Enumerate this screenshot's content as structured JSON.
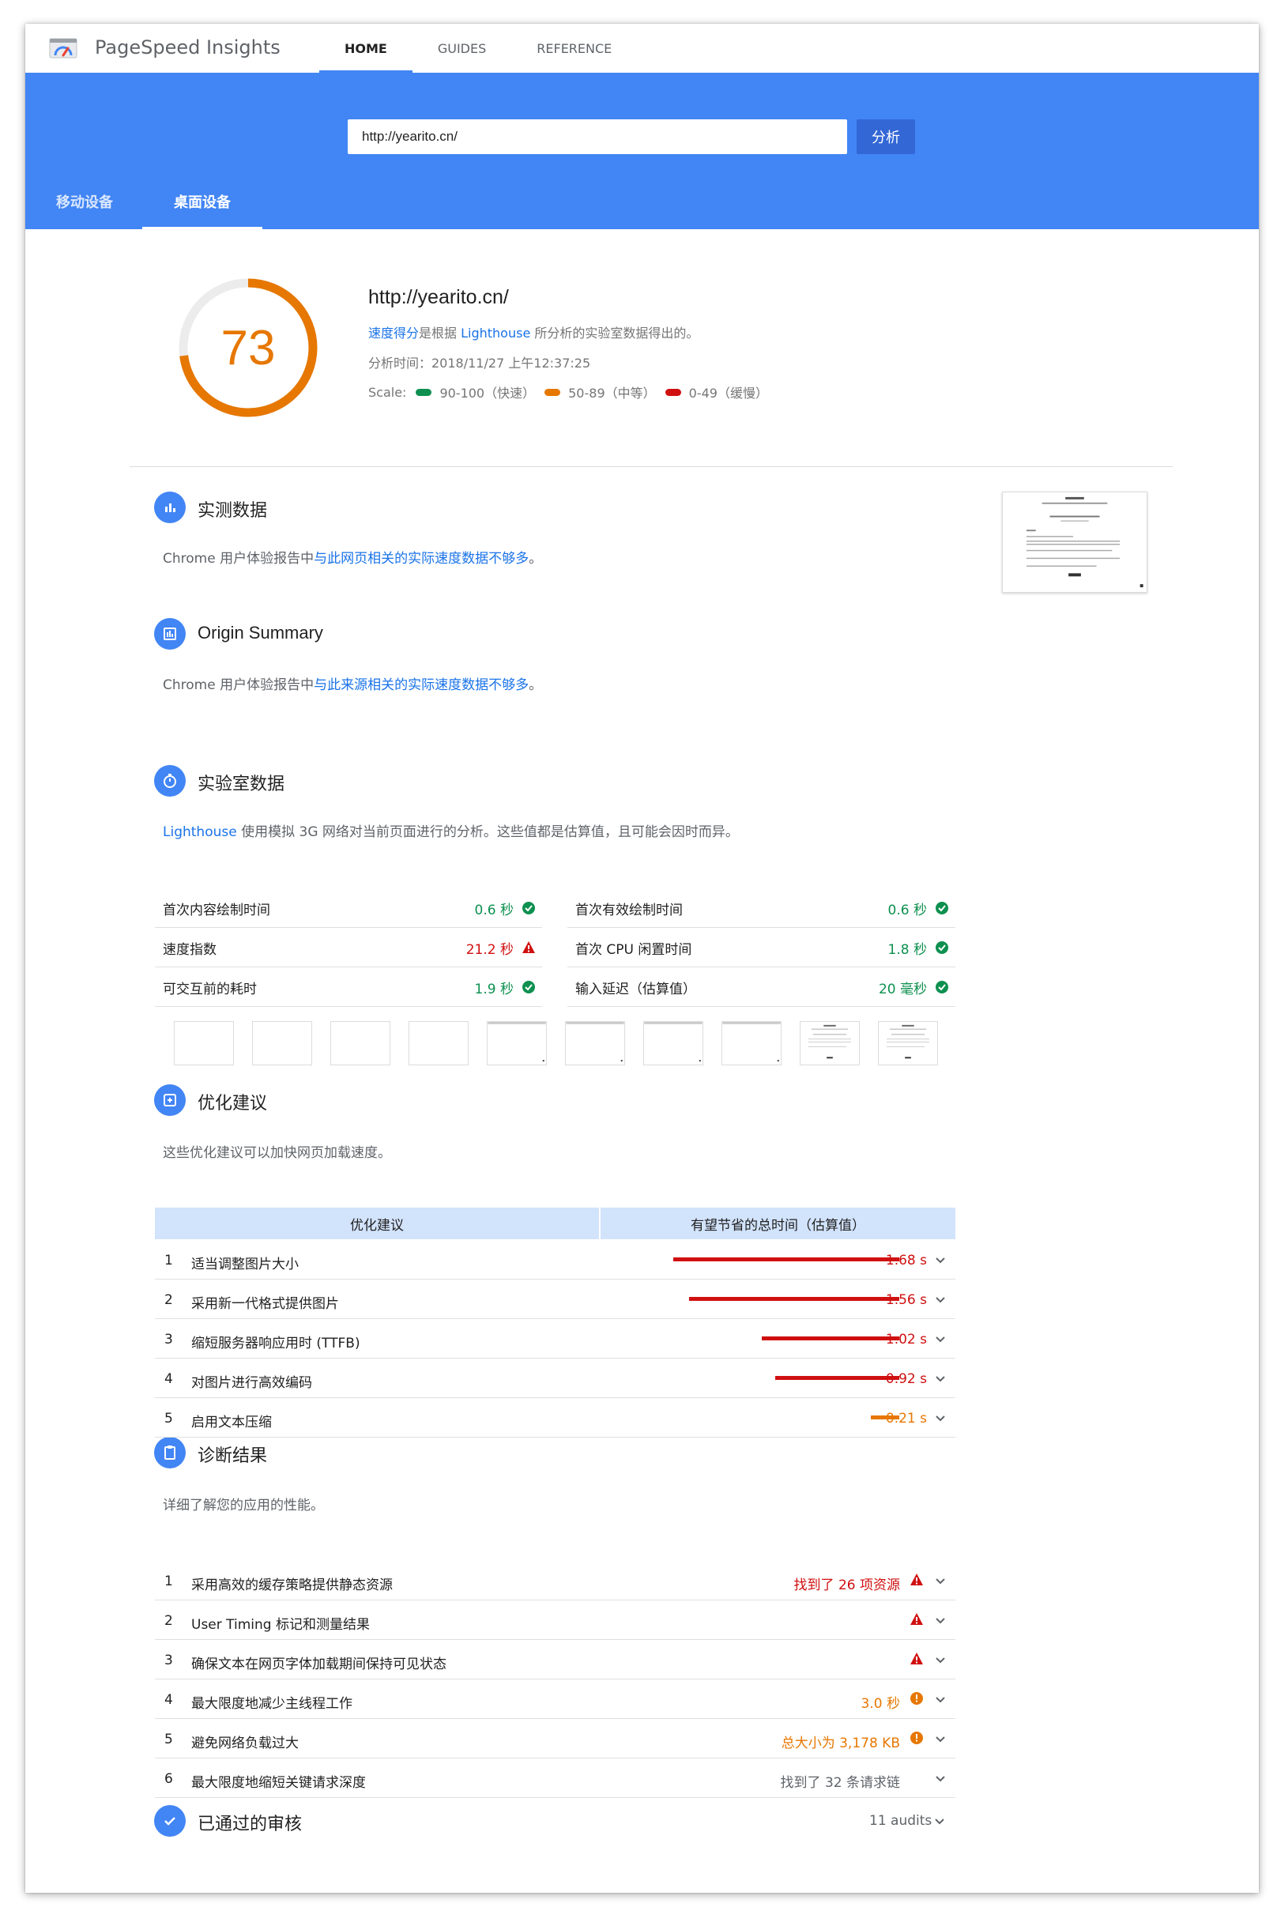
{
  "header": {
    "brand": "PageSpeed Insights",
    "nav": [
      "HOME",
      "GUIDES",
      "REFERENCE"
    ]
  },
  "search": {
    "url_value": "http://yearito.cn/",
    "analyze_label": "分析"
  },
  "device_tabs": [
    "移动设备",
    "桌面设备"
  ],
  "score": {
    "value": "73",
    "percent": 73,
    "url": "http://yearito.cn/",
    "desc_link1": "速度得分",
    "desc_mid": "是根据 ",
    "desc_link2": "Lighthouse",
    "desc_end": " 所分析的实验室数据得出的。",
    "analysis_time": "分析时间：2018/11/27 上午12:37:25",
    "scale_label": "Scale:",
    "scale_fast": "90-100（快速）",
    "scale_mid": "50-89（中等）",
    "scale_slow": "0-49（缓慢）",
    "colors": {
      "good": "#0d904f",
      "average": "#e67700",
      "poor": "#d01010"
    }
  },
  "field_data": {
    "title": "实测数据",
    "text_prefix": "Chrome 用户体验报告中",
    "text_link": "与此网页相关的实际速度数据不够多",
    "text_suffix": "。"
  },
  "origin_summary": {
    "title": "Origin Summary",
    "text_prefix": "Chrome 用户体验报告中",
    "text_link": "与此来源相关的实际速度数据不够多",
    "text_suffix": "。"
  },
  "lab_data": {
    "title": "实验室数据",
    "text_link": "Lighthouse",
    "text_rest": " 使用模拟 3G 网络对当前页面进行的分析。这些值都是估算值，且可能会因时而异。",
    "metrics": [
      {
        "label": "首次内容绘制时间",
        "value": "0.6 秒",
        "status": "good"
      },
      {
        "label": "首次有效绘制时间",
        "value": "0.6 秒",
        "status": "good"
      },
      {
        "label": "速度指数",
        "value": "21.2 秒",
        "status": "bad"
      },
      {
        "label": "首次 CPU 闲置时间",
        "value": "1.8 秒",
        "status": "good"
      },
      {
        "label": "可交互前的耗时",
        "value": "1.9 秒",
        "status": "good"
      },
      {
        "label": "输入延迟（估算值）",
        "value": "20 毫秒",
        "status": "good"
      }
    ]
  },
  "opportunities": {
    "title": "优化建议",
    "text": "这些优化建议可以加快网页加载速度。",
    "col1": "优化建议",
    "col2": "有望节省的总时间（估算值）",
    "rows": [
      {
        "idx": "1",
        "name": "适当调整图片大小",
        "time": "1.68 s",
        "seconds": 1.68,
        "color": "#d01010"
      },
      {
        "idx": "2",
        "name": "采用新一代格式提供图片",
        "time": "1.56 s",
        "seconds": 1.56,
        "color": "#d01010"
      },
      {
        "idx": "3",
        "name": "缩短服务器响应用时 (TTFB)",
        "time": "1.02 s",
        "seconds": 1.02,
        "color": "#d01010"
      },
      {
        "idx": "4",
        "name": "对图片进行高效编码",
        "time": "0.92 s",
        "seconds": 0.92,
        "color": "#d01010"
      },
      {
        "idx": "5",
        "name": "启用文本压缩",
        "time": "0.21 s",
        "seconds": 0.21,
        "color": "#e67700"
      }
    ]
  },
  "diagnostics": {
    "title": "诊断结果",
    "text": "详细了解您的应用的性能。",
    "rows": [
      {
        "idx": "1",
        "name": "采用高效的缓存策略提供静态资源",
        "value": "找到了 26 项资源",
        "status": "bad"
      },
      {
        "idx": "2",
        "name": "User Timing 标记和测量结果",
        "value": "",
        "status": "bad"
      },
      {
        "idx": "3",
        "name": "确保文本在网页字体加载期间保持可见状态",
        "value": "",
        "status": "bad"
      },
      {
        "idx": "4",
        "name": "最大限度地减少主线程工作",
        "value": "3.0 秒",
        "status": "average"
      },
      {
        "idx": "5",
        "name": "避免网络负载过大",
        "value": "总大小为 3,178 KB",
        "status": "average"
      },
      {
        "idx": "6",
        "name": "最大限度地缩短关键请求深度",
        "value": "找到了 32 条请求链",
        "status": "info"
      }
    ]
  },
  "passed": {
    "title": "已通过的审核",
    "count": "11 audits"
  }
}
